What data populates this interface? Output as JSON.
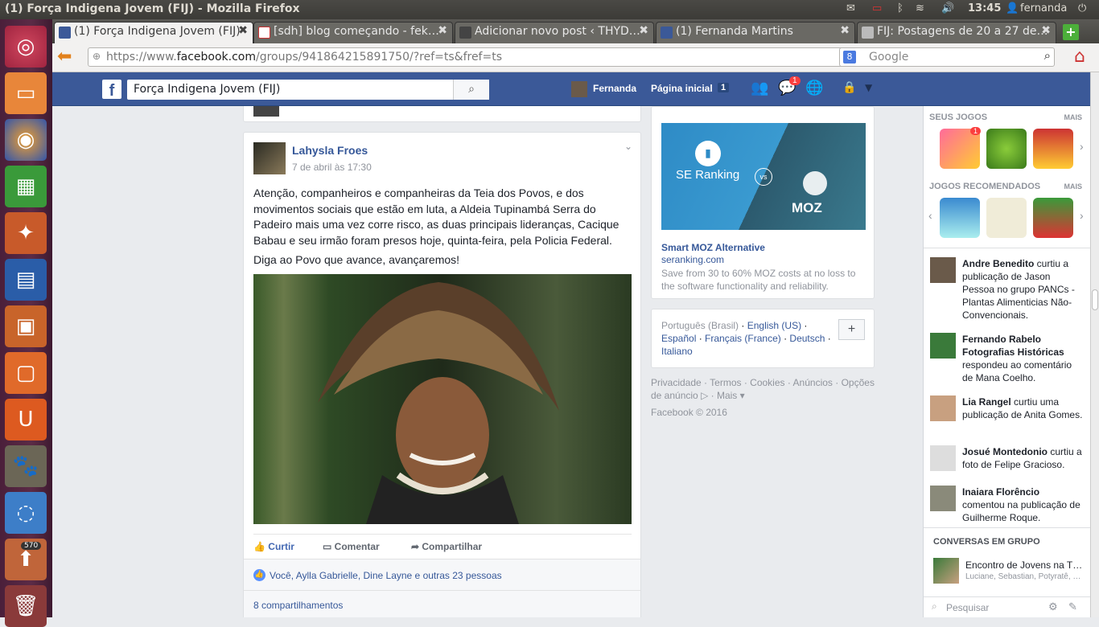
{
  "window": {
    "title": "(1) Força Indigena Jovem (FIJ) - Mozilla Firefox"
  },
  "system": {
    "time": "13:45",
    "user": "fernanda"
  },
  "launcher": {
    "badge": "570"
  },
  "tabs": [
    {
      "label": "(1) Força Indigena Jovem (FIJ)",
      "active": true,
      "icon": "facebook-icon"
    },
    {
      "label": "[sdh] blog começando - fek…",
      "active": false,
      "icon": "gmail-icon"
    },
    {
      "label": "Adicionar novo post ‹ THYD…",
      "active": false,
      "icon": "wordpress-icon"
    },
    {
      "label": "(1) Fernanda Martins",
      "active": false,
      "icon": "facebook-icon"
    },
    {
      "label": "FIJ: Postagens de 20 a 27 de…",
      "active": false,
      "icon": "page-icon"
    }
  ],
  "nav": {
    "url_prefix": "https://www.",
    "url_domain": "facebook.com",
    "url_rest": "/groups/941864215891750/?ref=ts&fref=ts",
    "search_placeholder": "Google"
  },
  "fb": {
    "search_value": "Força Indigena Jovem (FIJ)",
    "user": "Fernanda",
    "home": "Página inicial",
    "home_count": "1",
    "msg_count": "1"
  },
  "post": {
    "author": "Lahysla Froes",
    "time": "7 de abril às 17:30",
    "text1": "Atenção, companheiros e companheiras da Teia dos Povos, e dos movimentos sociais que estão em luta, a Aldeia Tupinambá Serra do Padeiro mais uma vez corre risco, as duas principais lideranças, Cacique Babau e seu irmão foram presos hoje, quinta-feira, pela Policia Federal.",
    "text2": "Diga ao Povo que avance, avançaremos!",
    "like": "Curtir",
    "comment": "Comentar",
    "share": "Compartilhar",
    "likes_text": "Você, Aylla Gabrielle, Dine Layne e outras 23 pessoas",
    "shares_text": "8 compartilhamentos"
  },
  "ad": {
    "brand_left": "SE Ranking",
    "vs": "vs",
    "brand_right": "MOZ",
    "title": "Smart MOZ Alternative",
    "domain": "seranking.com",
    "desc": "Save from 30 to 60% MOZ costs at no loss to the software functionality and reliability."
  },
  "languages": {
    "current": "Português (Brasil)",
    "options": [
      "English (US)",
      "Español",
      "Français (France)",
      "Deutsch",
      "Italiano"
    ],
    "add": "+"
  },
  "footer": {
    "links": [
      "Privacidade",
      "Termos",
      "Cookies",
      "Anúncios",
      "Opções de anúncio",
      "Mais"
    ],
    "copyright": "Facebook © 2016"
  },
  "sidebar": {
    "your_games": "SEUS JOGOS",
    "recommended": "JOGOS RECOMENDADOS",
    "more": "MAIS",
    "game_badge": "1",
    "ticker": [
      {
        "name": "Andre Benedito",
        "text": " curtiu a publicação de Jason Pessoa no grupo PANCs - Plantas Alimenticias Não-Convencionais."
      },
      {
        "name": "Fernando Rabelo Fotografias Históricas",
        "text": " respondeu ao comentário de Mana Coelho."
      },
      {
        "name": "Lia Rangel",
        "text": " curtiu uma publicação de Anita Gomes."
      },
      {
        "name": "Josué Montedonio",
        "text": " curtiu a foto de Felipe Gracioso."
      },
      {
        "name": "Inaiara Florêncio",
        "text": " comentou na publicação de Guilherme Roque."
      }
    ],
    "group_chats": "CONVERSAS EM GRUPO",
    "chat_title": "Encontro de Jovens na T…",
    "chat_members": "Luciane, Sebastian, Potyratê, …",
    "search_placeholder": "Pesquisar"
  }
}
